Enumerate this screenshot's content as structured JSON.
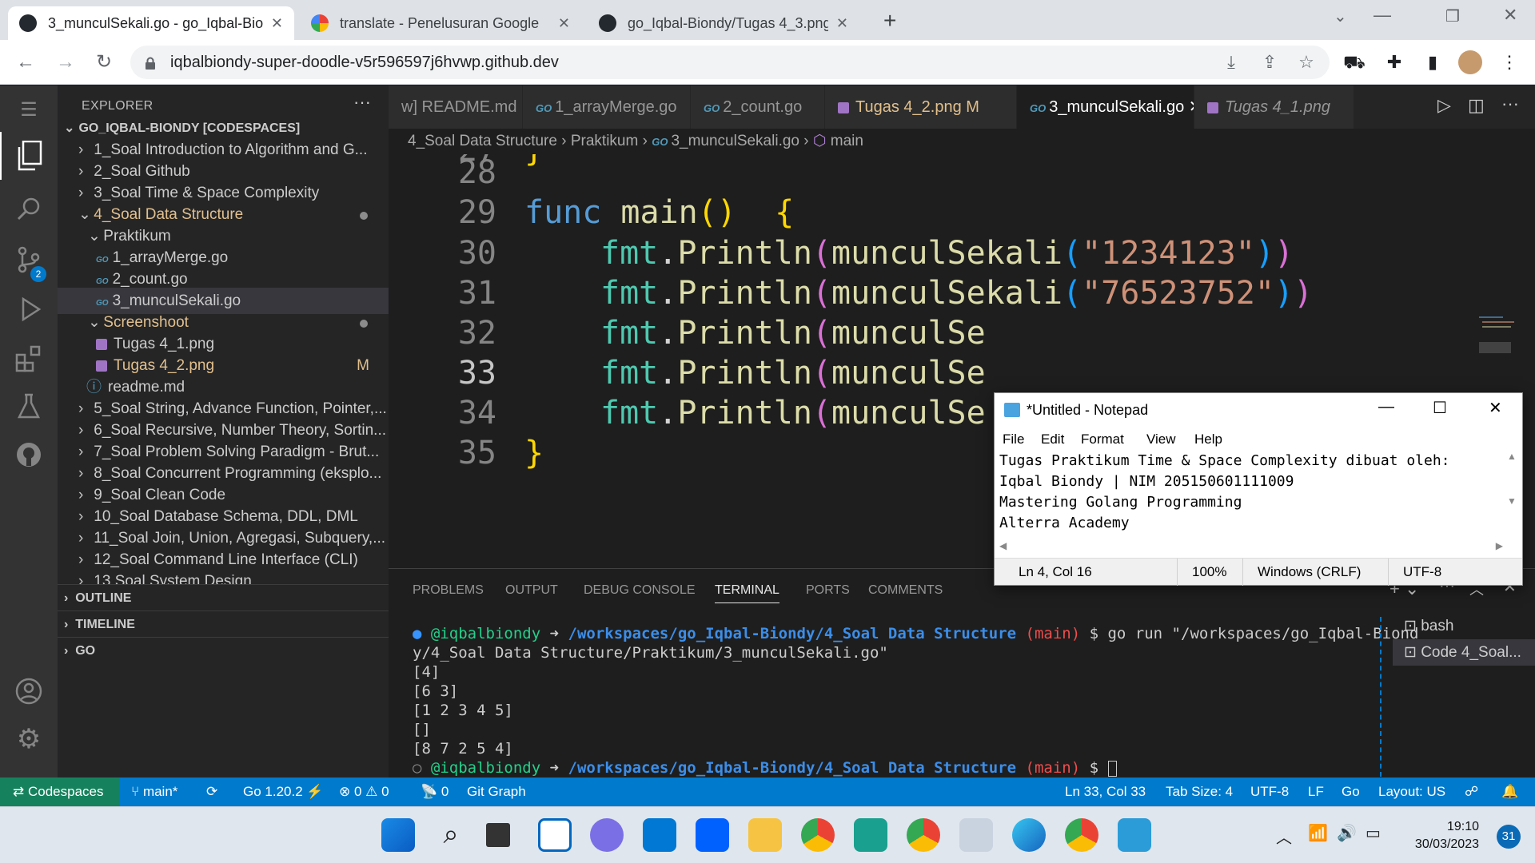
{
  "browser": {
    "tabs": [
      {
        "title": "3_munculSekali.go - go_Iqbal-Bio",
        "active": true,
        "favicon": "github-icon"
      },
      {
        "title": "translate - Penelusuran Google",
        "active": false,
        "favicon": "google-icon"
      },
      {
        "title": "go_Iqbal-Biondy/Tugas 4_3.png",
        "active": false,
        "favicon": "github-icon"
      }
    ],
    "url": "iqbalbiondy-super-doodle-v5r596597j6hvwp.github.dev"
  },
  "explorer": {
    "title": "EXPLORER",
    "root": "GO_IQBAL-BIONDY [CODESPACES]",
    "items": [
      {
        "label": "1_Soal Introduction to Algorithm and G...",
        "chev": "›"
      },
      {
        "label": "2_Soal Github",
        "chev": "›"
      },
      {
        "label": "3_Soal Time & Space Complexity",
        "chev": "›"
      },
      {
        "label": "4_Soal Data Structure",
        "chev": "⌄"
      },
      {
        "label": "Praktikum",
        "chev": "⌄"
      },
      {
        "label": "1_arrayMerge.go"
      },
      {
        "label": "2_count.go"
      },
      {
        "label": "3_munculSekali.go"
      },
      {
        "label": "Screenshoot",
        "chev": "⌄"
      },
      {
        "label": "Tugas 4_1.png"
      },
      {
        "label": "Tugas 4_2.png",
        "flag": "M"
      },
      {
        "label": "readme.md"
      },
      {
        "label": "5_Soal String, Advance Function, Pointer,...",
        "chev": "›"
      },
      {
        "label": "6_Soal Recursive, Number Theory, Sortin...",
        "chev": "›"
      },
      {
        "label": "7_Soal Problem Solving Paradigm - Brut...",
        "chev": "›"
      },
      {
        "label": "8_Soal Concurrent Programming (eksplo...",
        "chev": "›"
      },
      {
        "label": "9_Soal Clean Code",
        "chev": "›"
      },
      {
        "label": "10_Soal Database Schema, DDL, DML",
        "chev": "›"
      },
      {
        "label": "11_Soal Join, Union, Agregasi, Subquery,...",
        "chev": "›"
      },
      {
        "label": "12_Soal Command Line Interface (CLI)",
        "chev": "›"
      },
      {
        "label": "13 Soal System Design",
        "chev": "›"
      }
    ],
    "sections": [
      "OUTLINE",
      "TIMELINE",
      "GO"
    ],
    "scm_badge": "2"
  },
  "editor": {
    "tabs": [
      {
        "label": "w] README.md"
      },
      {
        "label": "1_arrayMerge.go"
      },
      {
        "label": "2_count.go"
      },
      {
        "label": "Tugas 4_2.png",
        "flag": "M"
      },
      {
        "label": "3_munculSekali.go"
      },
      {
        "label": "Tugas 4_1.png"
      }
    ],
    "breadcrumbs": [
      "4_Soal Data Structure",
      "Praktikum",
      "3_munculSekali.go",
      "main"
    ],
    "lines": [
      {
        "n": "27",
        "text": "}"
      },
      {
        "n": "28",
        "text": ""
      },
      {
        "n": "29",
        "text": "func main()  {"
      },
      {
        "n": "30",
        "text": "fmt.Println(munculSekali(\"1234123\"))"
      },
      {
        "n": "31",
        "text": "fmt.Println(munculSekali(\"76523752\"))"
      },
      {
        "n": "32",
        "text": "fmt.Println(munculSe"
      },
      {
        "n": "33",
        "text": "fmt.Println(munculSe"
      },
      {
        "n": "34",
        "text": "fmt.Println(munculSe"
      },
      {
        "n": "35",
        "text": "}"
      }
    ]
  },
  "panel": {
    "tabs": [
      "PROBLEMS",
      "OUTPUT",
      "DEBUG CONSOLE",
      "TERMINAL",
      "PORTS",
      "COMMENTS"
    ],
    "active_tab": "TERMINAL",
    "user": "@iqbalbiondy",
    "arrow": "➜",
    "path": "/workspaces/go_Iqbal-Biondy/4_Soal Data Structure",
    "branch": "(main)",
    "command": "$ go run \"/workspaces/go_Iqbal-Biond",
    "command_wrap": "y/4_Soal Data Structure/Praktikum/3_munculSekali.go\"",
    "output": [
      "[4]",
      "[6 3]",
      "[1 2 3 4 5]",
      "[]",
      "[8 7 2 5 4]"
    ],
    "prompt_end": "$",
    "terminals": [
      "bash",
      "Code 4_Soal..."
    ]
  },
  "notepad": {
    "title": "*Untitled - Notepad",
    "menu": [
      "File",
      "Edit",
      "Format",
      "View",
      "Help"
    ],
    "lines": [
      "Tugas Praktikum Time & Space Complexity dibuat oleh:",
      "Iqbal Biondy | NIM 205150601111009",
      "Mastering Golang Programming",
      "Alterra Academy"
    ],
    "status": {
      "pos": "Ln 4, Col 16",
      "zoom": "100%",
      "eol": "Windows (CRLF)",
      "enc": "UTF-8"
    }
  },
  "statusbar": {
    "remote": "Codespaces",
    "branch": "main*",
    "go": "Go 1.20.2",
    "problems": "⊗ 0 ⚠ 0",
    "ports": "0",
    "gitgraph": "Git Graph",
    "cursor": "Ln 33, Col 33",
    "tabsize": "Tab Size: 4",
    "encoding": "UTF-8",
    "eol": "LF",
    "lang": "Go",
    "layout": "Layout: US"
  },
  "taskbar": {
    "time": "19:10",
    "date": "30/03/2023",
    "notifications": "31"
  },
  "colors": {
    "vscode_accent": "#007acc",
    "remote": "#16825d"
  }
}
